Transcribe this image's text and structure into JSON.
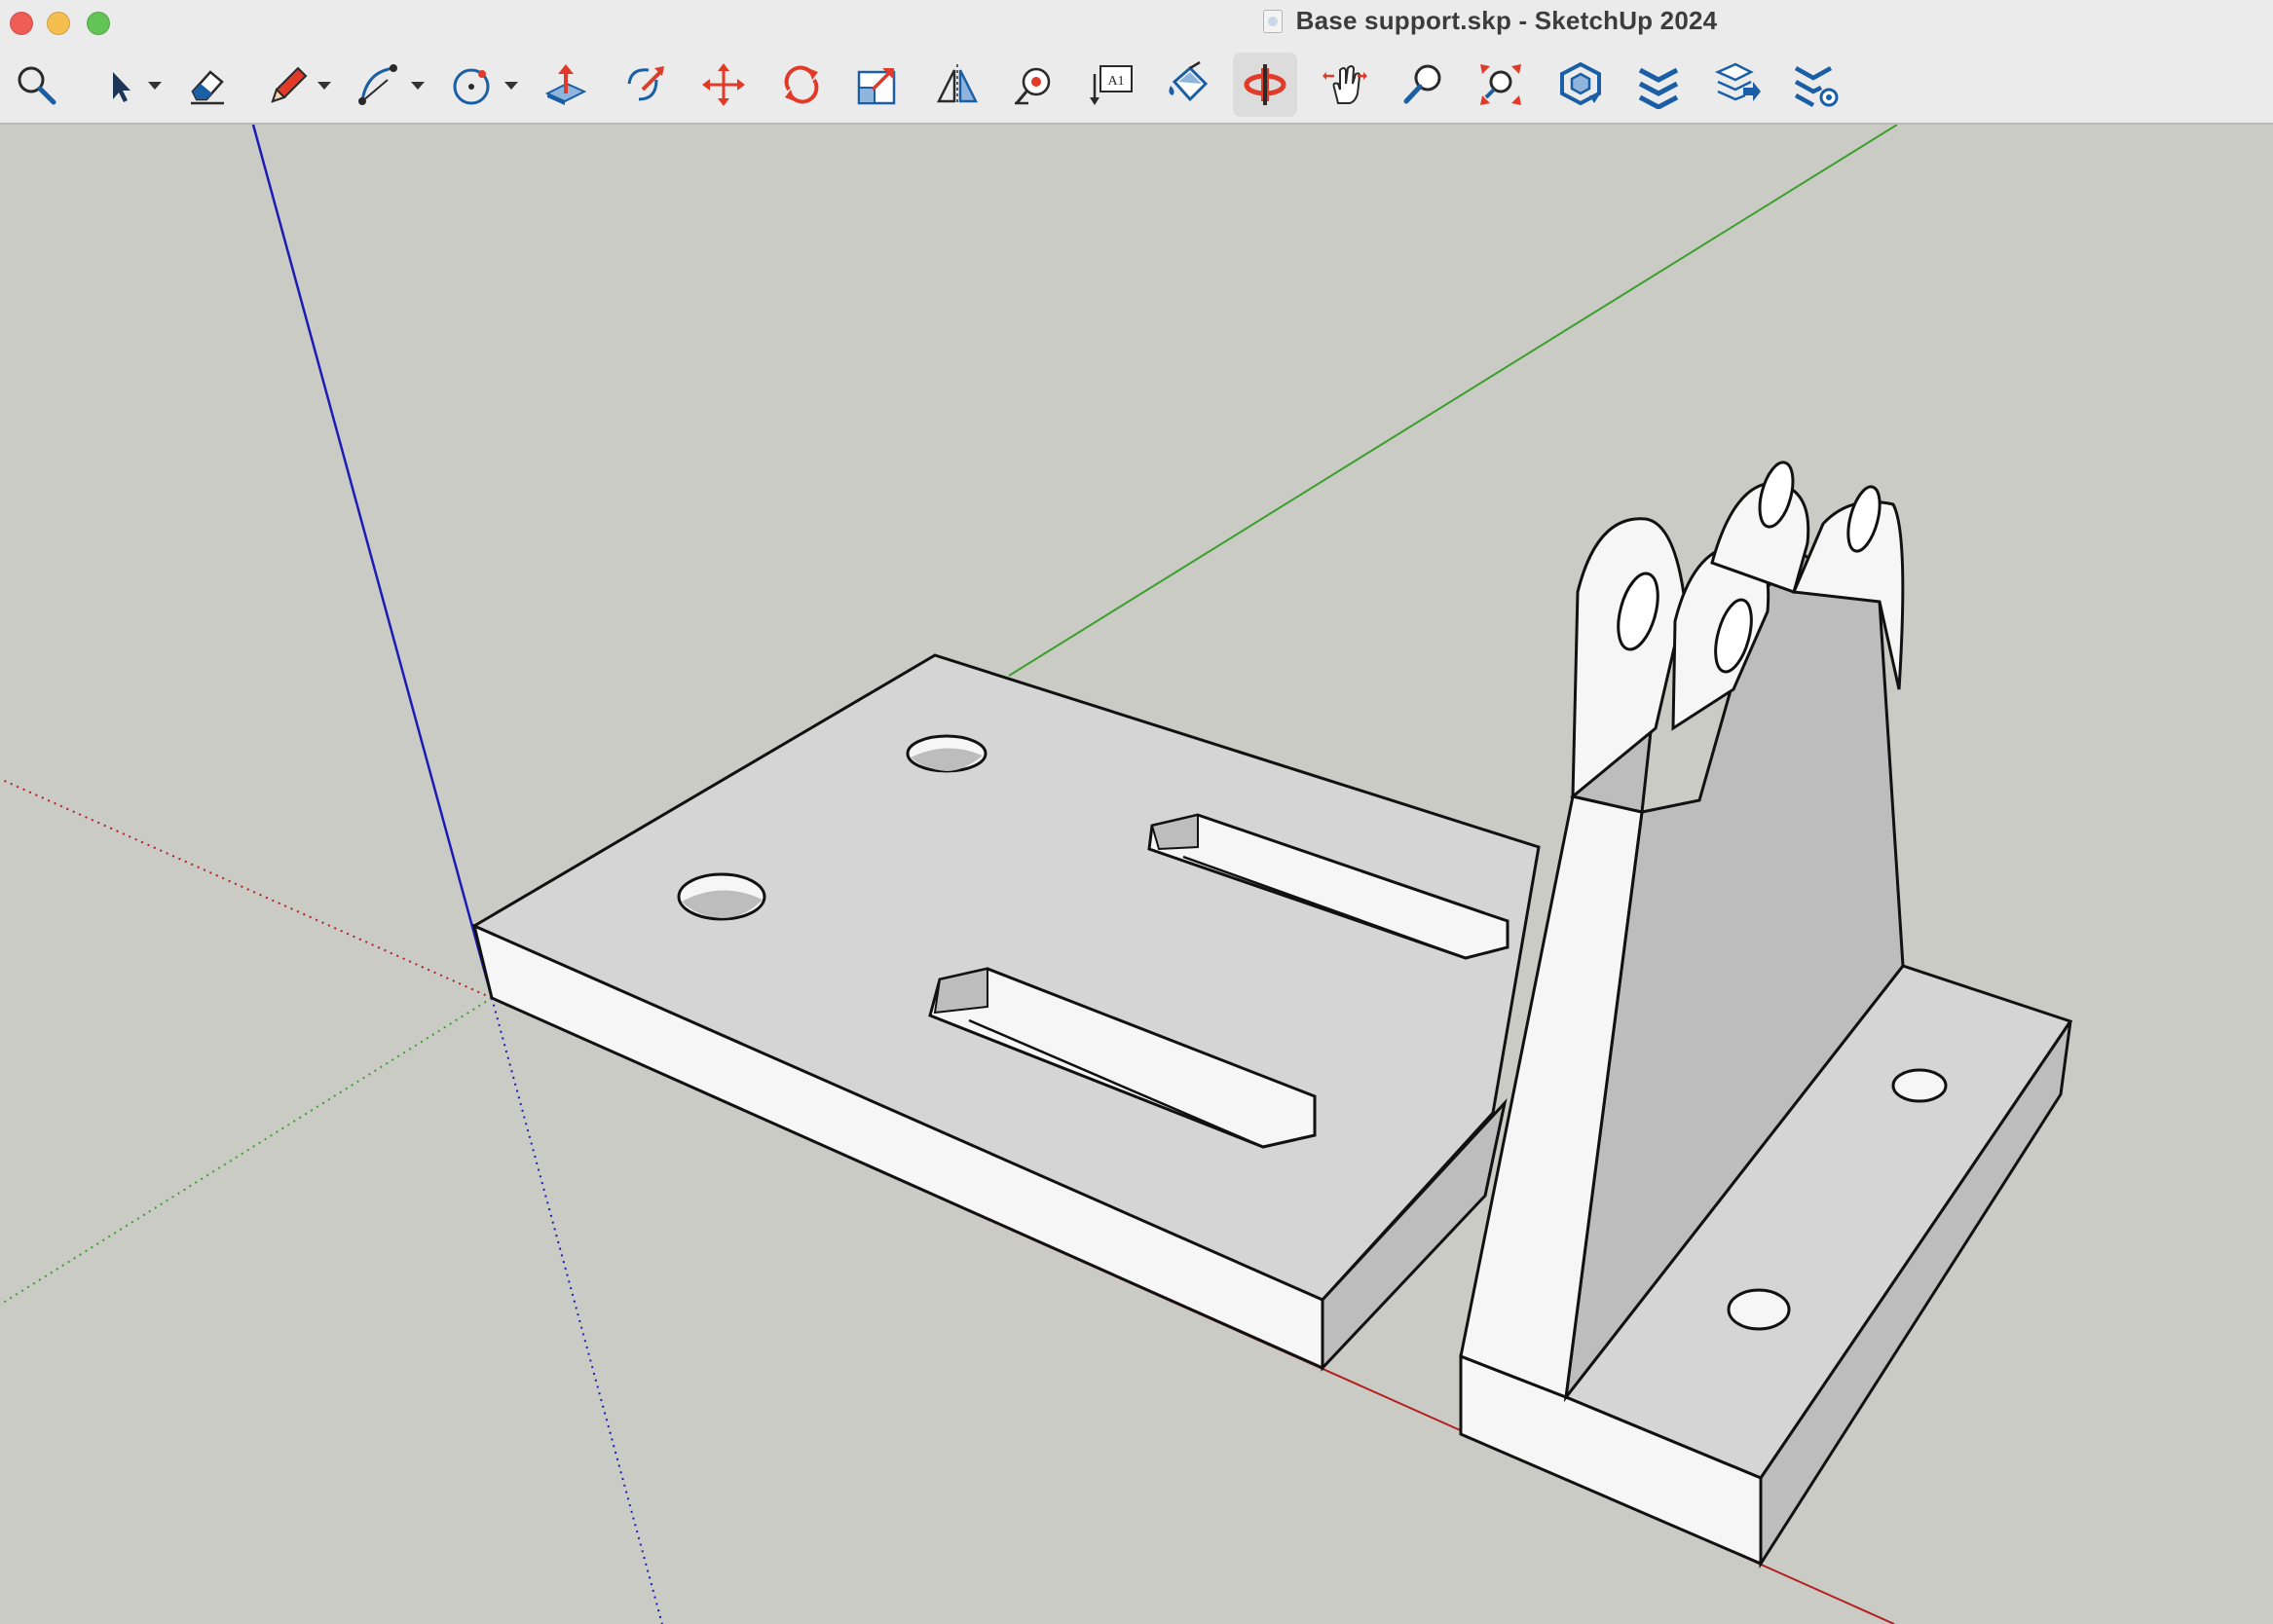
{
  "window": {
    "title": "Base support.skp - SketchUp 2024",
    "traffic_lights": [
      {
        "name": "close-button",
        "color": "#ee5e57"
      },
      {
        "name": "minimize-button",
        "color": "#f4be4f"
      },
      {
        "name": "zoom-button",
        "color": "#62c454"
      }
    ]
  },
  "toolbar": {
    "tools": [
      {
        "name": "search-tool",
        "icon": "search-icon"
      },
      {
        "name": "select-tool",
        "icon": "select-arrow-icon",
        "dropdown": true
      },
      {
        "name": "eraser-tool",
        "icon": "eraser-icon"
      },
      {
        "name": "line-tool",
        "icon": "pencil-icon",
        "dropdown": true
      },
      {
        "name": "arc-tool",
        "icon": "arc-icon",
        "dropdown": true
      },
      {
        "name": "shapes-tool",
        "icon": "circle-icon",
        "dropdown": true
      },
      {
        "name": "push-pull-tool",
        "icon": "push-pull-icon"
      },
      {
        "name": "follow-me-tool",
        "icon": "follow-me-icon"
      },
      {
        "name": "move-tool",
        "icon": "move-icon"
      },
      {
        "name": "rotate-tool",
        "icon": "rotate-icon"
      },
      {
        "name": "scale-tool",
        "icon": "scale-icon"
      },
      {
        "name": "flip-tool",
        "icon": "flip-icon"
      },
      {
        "name": "tape-measure-tool",
        "icon": "tape-measure-icon"
      },
      {
        "name": "text-tool",
        "icon": "text-label-icon",
        "label": "A1"
      },
      {
        "name": "paint-bucket-tool",
        "icon": "paint-bucket-icon"
      },
      {
        "name": "orbit-tool",
        "icon": "orbit-icon",
        "active": true
      },
      {
        "name": "pan-tool",
        "icon": "pan-hand-icon"
      },
      {
        "name": "zoom-tool",
        "icon": "zoom-icon"
      },
      {
        "name": "zoom-extents-tool",
        "icon": "zoom-extents-icon"
      },
      {
        "name": "3d-warehouse-tool",
        "icon": "3d-warehouse-icon"
      },
      {
        "name": "extension-warehouse-tool",
        "icon": "extension-warehouse-icon"
      },
      {
        "name": "send-to-layout-tool",
        "icon": "send-to-layout-icon"
      },
      {
        "name": "extension-manager-tool",
        "icon": "extension-manager-icon"
      }
    ],
    "colors": {
      "blue": "#1a5fa5",
      "red": "#e13a28",
      "dark": "#2a2a2a"
    }
  },
  "viewport": {
    "background": "#cbcbc6",
    "axes": {
      "red": "#b31f1f",
      "green": "#3aa02b",
      "blue": "#1b1bb5"
    },
    "model": {
      "objects": [
        "base-plate",
        "bracket"
      ],
      "face_colors": {
        "top": "#d5d5d5",
        "front": "#f6f6f6",
        "side": "#bdbdbd",
        "edge": "#111111"
      }
    }
  }
}
